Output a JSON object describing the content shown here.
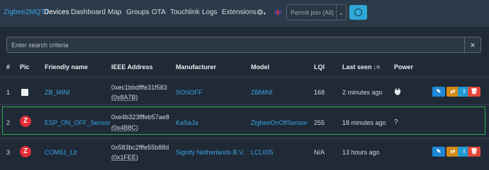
{
  "nav": {
    "brand": "Zigbee2MQTT",
    "links": [
      "Devices",
      "Dashboard",
      "Map",
      "Groups",
      "OTA",
      "Touchlink",
      "Logs",
      "Extensions"
    ],
    "permit_join": "Permit join (All)",
    "caret": "⌄"
  },
  "search": {
    "placeholder": "Enter search criteria",
    "value": "",
    "clear": "×"
  },
  "table": {
    "headers": {
      "num": "#",
      "pic": "Pic",
      "name": "Friendly name",
      "ieee": "IEEE Address",
      "manufacturer": "Manufacturer",
      "model": "Model",
      "lqi": "LQI",
      "last_seen": "Last seen",
      "power": "Power"
    },
    "sort_icon": "sort-descending-icon",
    "rows": [
      {
        "num": "1",
        "pic": "light-device",
        "name": "ZB_MINI",
        "ieee": "0xec1bbdfffe31f583",
        "nwk": "(0x8A7B)",
        "manufacturer": "SONOFF",
        "model": "ZBMINI",
        "lqi": "168",
        "last_seen": "2 minutes ago",
        "power": "plug-icon",
        "actions": true
      },
      {
        "num": "2",
        "pic": "zigbee-logo",
        "name": "ESP_ON_OFF_Sensor",
        "ieee": "0xe4b323fffeb57ae8",
        "nwk": "(0x4B8C)",
        "manufacturer": "KaSaJa",
        "model": "ZigbeeOnOffSensor",
        "lqi": "255",
        "last_seen": "18 minutes ago",
        "power": "?",
        "actions": false
      },
      {
        "num": "3",
        "pic": "zigbee-logo",
        "name": "COM61_Lit",
        "ieee": "0x583bc2fffe55b88d",
        "nwk": "(0x1FEE)",
        "manufacturer": "Signify Netherlands B.V.",
        "model": "LCL005",
        "lqi": "N/A",
        "last_seen": "13 hours ago",
        "power": "",
        "actions": true
      }
    ]
  },
  "colors": {
    "accent": "#3aa2e6",
    "highlight": "#34a853",
    "delete": "#e0473a",
    "rename": "#d48a1a"
  }
}
